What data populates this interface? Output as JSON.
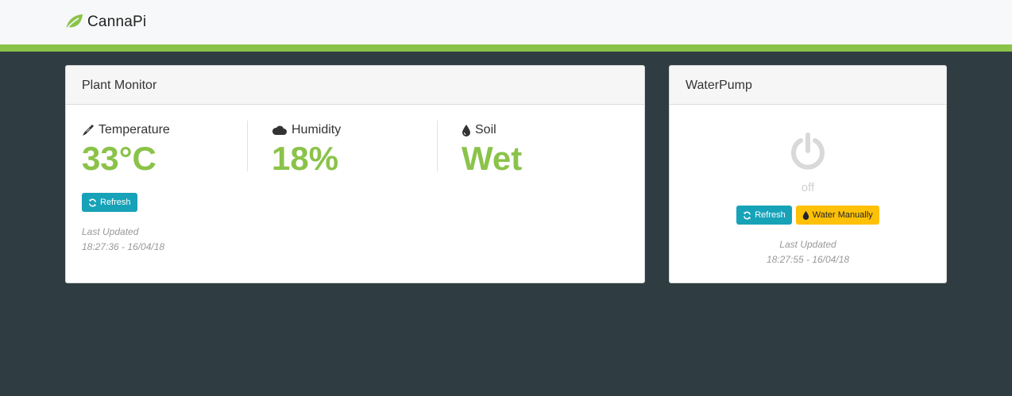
{
  "brand": {
    "name": "CannaPi",
    "icon": "leaf-icon",
    "color": "#8bc34a"
  },
  "plant_monitor": {
    "title": "Plant Monitor",
    "metrics": [
      {
        "label": "Temperature",
        "value": "33°C",
        "icon": "thermometer-icon"
      },
      {
        "label": "Humidity",
        "value": "18%",
        "icon": "cloud-icon"
      },
      {
        "label": "Soil",
        "value": "Wet",
        "icon": "water-drop-icon"
      }
    ],
    "refresh_label": "Refresh",
    "last_updated_label": "Last Updated",
    "last_updated_value": "18:27:36 - 16/04/18"
  },
  "water_pump": {
    "title": "WaterPump",
    "state": "off",
    "refresh_label": "Refresh",
    "water_label": "Water Manually",
    "last_updated_label": "Last Updated",
    "last_updated_value": "18:27:55 - 16/04/18"
  },
  "colors": {
    "accent": "#8bc34a",
    "background": "#2f3d42",
    "info_button": "#17a2b8",
    "warning_button": "#ffc107"
  }
}
